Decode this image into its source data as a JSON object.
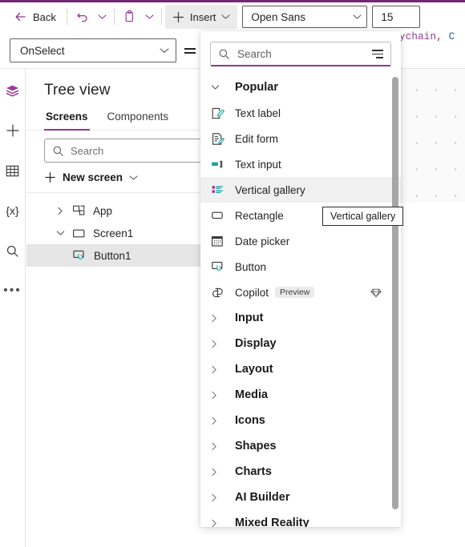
{
  "theme": {
    "accent": "#742774",
    "purple": "#8e3b8e",
    "teal": "#0f8b8d",
    "selected_bg": "#e6e6e6",
    "hover_bg": "#f0f0f0"
  },
  "command_bar": {
    "back_label": "Back",
    "undo_icon": "undo-icon",
    "undo_chevron_icon": "chevron-down-icon",
    "paste_icon": "clipboard-paste-icon",
    "paste_chevron_icon": "chevron-down-icon",
    "insert_label": "Insert",
    "insert_plus_icon": "plus-icon",
    "insert_chevron_icon": "chevron-down-icon",
    "font_family_value": "Open Sans",
    "font_family_chevron_icon": "chevron-down-icon",
    "font_size_value": "15"
  },
  "property_bar": {
    "property_value": "OnSelect",
    "property_chevron_icon": "chevron-down-icon",
    "fx_toggle_icon": "formula-expand-icon",
    "formula_fragment_1": "ychain",
    "formula_fragment_2": ",",
    "formula_fragment_3": "C"
  },
  "rail": {
    "items": [
      {
        "icon": "tree-view-layers-icon",
        "active": true
      },
      {
        "icon": "insert-plus-icon",
        "active": false
      },
      {
        "icon": "data-table-icon",
        "active": false
      },
      {
        "icon": "variables-icon",
        "label": "{x}",
        "active": false
      },
      {
        "icon": "search-icon",
        "active": false
      },
      {
        "icon": "more-options-icon",
        "label": "•••",
        "active": false
      }
    ]
  },
  "tree_view": {
    "title": "Tree view",
    "tabs": [
      {
        "label": "Screens",
        "active": true
      },
      {
        "label": "Components",
        "active": false
      }
    ],
    "search_placeholder": "Search",
    "search_icon": "search-icon",
    "new_screen_label": "New screen",
    "new_screen_plus_icon": "plus-icon",
    "new_screen_chevron_icon": "chevron-down-icon",
    "nodes": [
      {
        "label": "App",
        "icon": "app-icon",
        "twisty": "chevron-right-icon",
        "indent": 0,
        "selected": false
      },
      {
        "label": "Screen1",
        "icon": "screen-icon",
        "twisty": "chevron-down-icon",
        "indent": 0,
        "selected": false
      },
      {
        "label": "Button1",
        "icon": "button-control-icon",
        "twisty": "",
        "indent": 1,
        "selected": true
      }
    ]
  },
  "insert_panel": {
    "search_placeholder": "Search",
    "search_icon": "search-icon",
    "filter_icon": "filter-icon",
    "group_popular": {
      "label": "Popular",
      "chevron_icon": "chevron-down-icon",
      "expanded": true
    },
    "popular_items": [
      {
        "label": "Text label",
        "icon": "text-label-icon",
        "hovered": false
      },
      {
        "label": "Edit form",
        "icon": "edit-form-icon",
        "hovered": false
      },
      {
        "label": "Text input",
        "icon": "text-input-icon",
        "hovered": false
      },
      {
        "label": "Vertical gallery",
        "icon": "vertical-gallery-icon",
        "hovered": true
      },
      {
        "label": "Rectangle",
        "icon": "rectangle-icon",
        "hovered": false
      },
      {
        "label": "Date picker",
        "icon": "date-picker-icon",
        "hovered": false
      },
      {
        "label": "Button",
        "icon": "button-control-icon",
        "hovered": false
      },
      {
        "label": "Copilot",
        "icon": "copilot-icon",
        "badge": "Preview",
        "trailing_icon": "premium-gem-icon",
        "hovered": false
      }
    ],
    "collapsed_groups": [
      {
        "label": "Input",
        "chevron_icon": "chevron-right-icon"
      },
      {
        "label": "Display",
        "chevron_icon": "chevron-right-icon"
      },
      {
        "label": "Layout",
        "chevron_icon": "chevron-right-icon"
      },
      {
        "label": "Media",
        "chevron_icon": "chevron-right-icon"
      },
      {
        "label": "Icons",
        "chevron_icon": "chevron-right-icon"
      },
      {
        "label": "Shapes",
        "chevron_icon": "chevron-right-icon"
      },
      {
        "label": "Charts",
        "chevron_icon": "chevron-right-icon"
      },
      {
        "label": "AI Builder",
        "chevron_icon": "chevron-right-icon"
      },
      {
        "label": "Mixed Reality",
        "chevron_icon": "chevron-right-icon"
      }
    ],
    "scrollbar": {
      "orientation": "vertical"
    }
  },
  "tooltip": {
    "text": "Vertical gallery"
  }
}
